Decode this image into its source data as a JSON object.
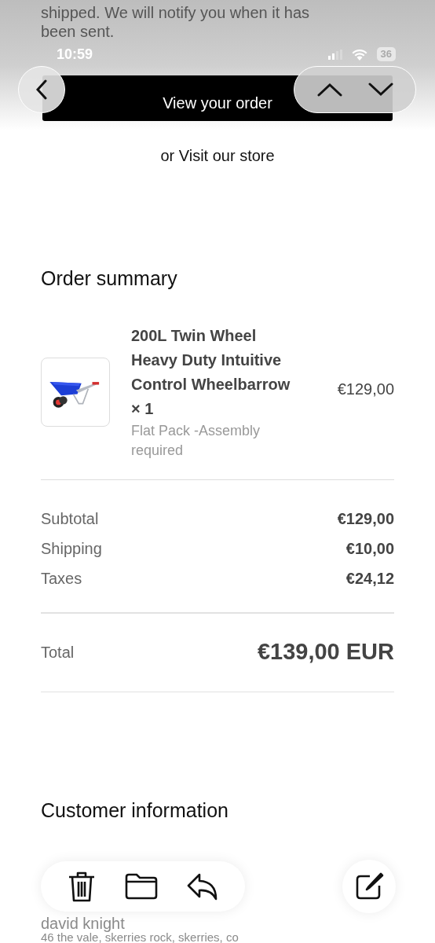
{
  "notice": {
    "lines": [
      "shipped. We will notify you when it has",
      "been sent."
    ]
  },
  "status_bar": {
    "time": "10:59",
    "battery": "36"
  },
  "primary_button": "View your order",
  "secondary_link": "or Visit our store",
  "order_summary": {
    "title": "Order summary",
    "items": [
      {
        "name": "200L Twin Wheel Heavy Duty Intuitive Control Wheelbarrow × 1",
        "variant": "Flat Pack -Assembly required",
        "price": "€129,00"
      }
    ],
    "lines": [
      {
        "label": "Subtotal",
        "value": "€129,00"
      },
      {
        "label": "Shipping",
        "value": "€10,00"
      },
      {
        "label": "Taxes",
        "value": "€24,12"
      }
    ],
    "total": {
      "label": "Total",
      "value": "€139,00 EUR"
    }
  },
  "customer_information": {
    "title": "Customer information",
    "lines": [
      "david knight",
      "46 the vale, skerries rock, skerries, co"
    ]
  }
}
